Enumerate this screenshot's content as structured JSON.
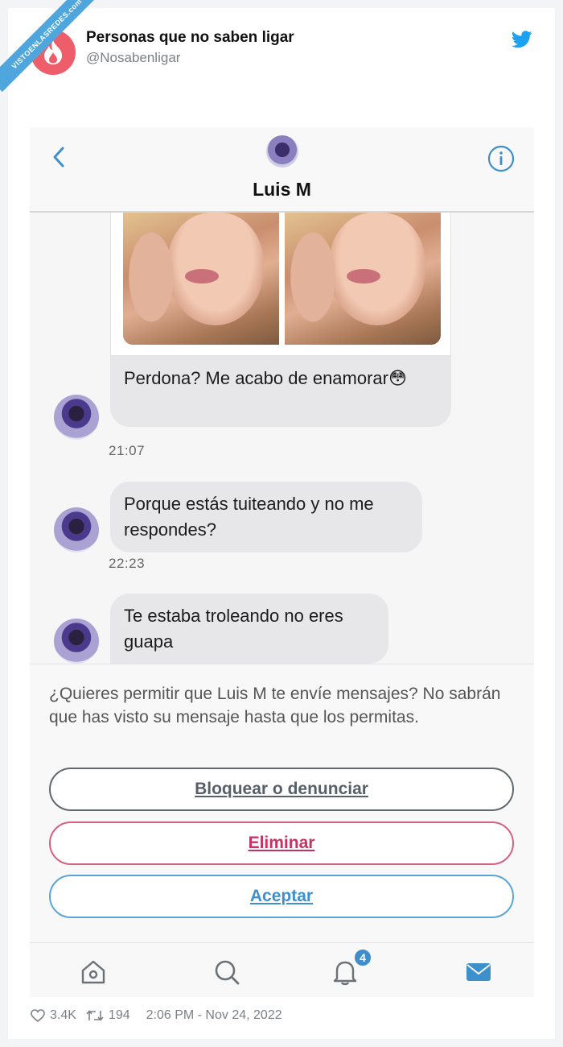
{
  "watermark": "VISTOENLASREDES.com",
  "tweet": {
    "author_name": "Personas que no saben ligar",
    "author_handle": "@Nosabenligar",
    "likes": "3.4K",
    "retweets": "194",
    "timestamp": "2:06 PM - Nov 24, 2022"
  },
  "dm": {
    "contact_name": "Luis M",
    "messages": [
      {
        "text": "Perdona? Me acabo de enamorar😳",
        "time": "21:07"
      },
      {
        "text": "Porque estás tuiteando y no me respondes?",
        "time": "22:23"
      },
      {
        "text": "Te estaba troleando no eres guapa",
        "time": ""
      }
    ],
    "request_text": "¿Quieres permitir que Luis M te envíe mensajes? No sabrán que has visto su mensaje hasta que los permitas.",
    "buttons": {
      "block": "Bloquear o denunciar",
      "delete": "Eliminar",
      "accept": "Aceptar"
    },
    "notification_count": "4"
  },
  "colors": {
    "twitter_blue": "#1da1f2",
    "accept_blue": "#3d90cb",
    "delete_pink": "#c53363",
    "block_gray": "#57606a",
    "bubble_gray": "#e7e7ea"
  },
  "icons": [
    "heart-icon",
    "retweet-icon",
    "twitter-bird-icon",
    "back-icon",
    "info-icon",
    "home-icon",
    "search-icon",
    "bell-icon",
    "mail-icon"
  ]
}
